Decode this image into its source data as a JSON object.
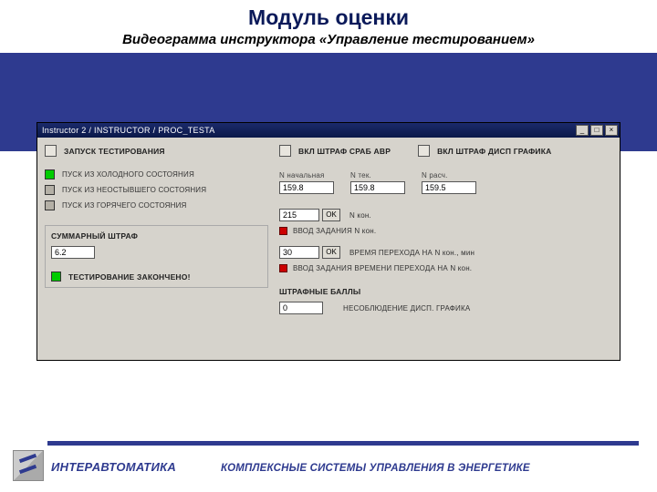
{
  "header": {
    "title": "Модуль оценки",
    "subtitle": "Видеограмма инструктора «Управление тестированием»"
  },
  "window": {
    "title": "Instructor 2 / INSTRUCTOR / PROC_TESTA",
    "buttons": {
      "min": "_",
      "max": "□",
      "close": "×"
    }
  },
  "left": {
    "launch_label": "ЗАПУСК ТЕСТИРОВАНИЯ",
    "items": [
      {
        "label": "ПУСК ИЗ ХОЛОДНОГО СОСТОЯНИЯ",
        "color": "green"
      },
      {
        "label": "ПУСК ИЗ НЕОСТЫВШЕГО СОСТОЯНИЯ",
        "color": "gray"
      },
      {
        "label": "ПУСК ИЗ ГОРЯЧЕГО СОСТОЯНИЯ",
        "color": "gray"
      }
    ],
    "penalty_label": "СУММАРНЫЙ ШТРАФ",
    "penalty_value": "6.2",
    "done_label": "ТЕСТИРОВАНИЕ ЗАКОНЧЕНО!"
  },
  "right_top": {
    "flags": [
      "ВКЛ ШТРАФ СРАБ АВР",
      "ВКЛ ШТРАФ ДИСП ГРАФИКА"
    ],
    "fields": [
      {
        "label": "N начальная",
        "value": "159.8"
      },
      {
        "label": "N тек.",
        "value": "159.8"
      },
      {
        "label": "N расч.",
        "value": "159.5"
      }
    ]
  },
  "right_inputs": {
    "row1": {
      "value": "215",
      "ok": "OK",
      "after": "N кон.",
      "hint": "ВВОД ЗАДАНИЯ N кон."
    },
    "row2": {
      "value": "30",
      "ok": "OK",
      "after": "ВРЕМЯ ПЕРЕХОДА НА N кон., мин",
      "hint": "ВВОД ЗАДАНИЯ ВРЕМЕНИ ПЕРЕХОДА НА N кон."
    }
  },
  "penalty_points": {
    "title": "ШТРАФНЫЕ БАЛЛЫ",
    "value": "0",
    "label": "НЕСОБЛЮДЕНИЕ ДИСП. ГРАФИКА"
  },
  "footer": {
    "brand": "ИНТЕРАВТОМАТИКА",
    "tagline": "КОМПЛЕКСНЫЕ СИСТЕМЫ УПРАВЛЕНИЯ В ЭНЕРГЕТИКЕ"
  }
}
